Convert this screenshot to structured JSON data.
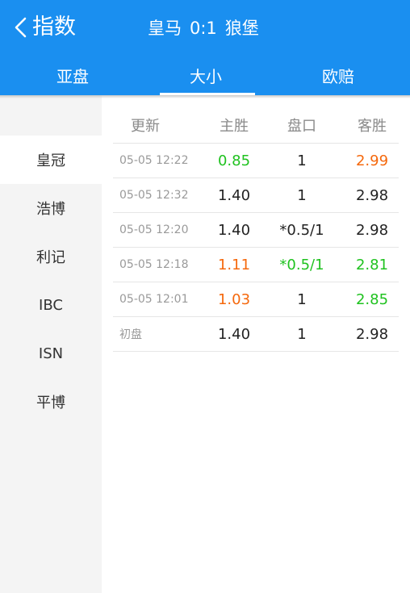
{
  "header": {
    "back_icon": "chevron-left-icon",
    "title": "指数",
    "match": {
      "home": "皇马",
      "score": "0:1",
      "away": "狼堡"
    }
  },
  "tabs": [
    {
      "label": "亚盘",
      "active": false
    },
    {
      "label": "大小",
      "active": true
    },
    {
      "label": "欧赔",
      "active": false
    }
  ],
  "sidebar": {
    "items": [
      {
        "label": "皇冠",
        "active": true
      },
      {
        "label": "浩博",
        "active": false
      },
      {
        "label": "利记",
        "active": false
      },
      {
        "label": "IBC",
        "active": false
      },
      {
        "label": "ISN",
        "active": false
      },
      {
        "label": "平博",
        "active": false
      }
    ]
  },
  "table": {
    "columns": [
      "更新",
      "主胜",
      "盘口",
      "客胜"
    ],
    "rows": [
      {
        "time": "05-05 12:22",
        "home": "0.85",
        "line": "1",
        "away": "2.99"
      },
      {
        "time": "05-05 12:32",
        "home": "1.40",
        "line": "1",
        "away": "2.98"
      },
      {
        "time": "05-05 12:20",
        "home": "1.40",
        "line": "*0.5/1",
        "away": "2.98"
      },
      {
        "time": "05-05 12:18",
        "home": "1.11",
        "line": "*0.5/1",
        "away": "2.81"
      },
      {
        "time": "05-05 12:01",
        "home": "1.03",
        "line": "1",
        "away": "2.85"
      },
      {
        "time": "初盘",
        "home": "1.40",
        "line": "1",
        "away": "2.98"
      }
    ]
  },
  "colors": {
    "brand": "#1a8ff0",
    "up": "#1fc21f",
    "down": "#f5680c"
  }
}
